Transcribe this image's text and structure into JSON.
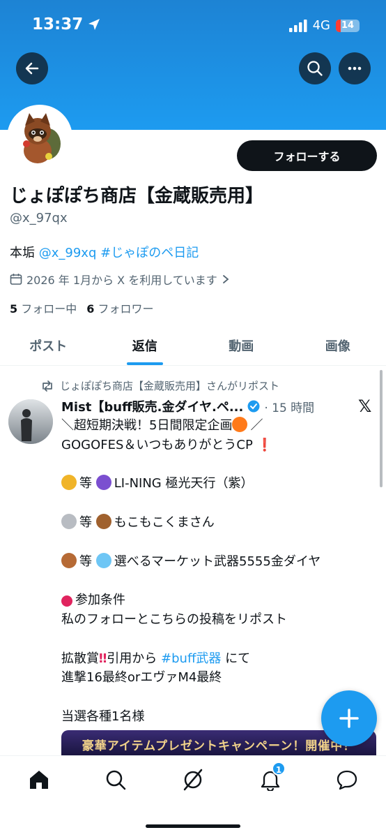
{
  "status_bar": {
    "time": "13:37",
    "network": "4G",
    "battery": "14"
  },
  "header": {
    "back_icon": "arrow-left-icon",
    "search_icon": "search-icon",
    "more_icon": "more-icon"
  },
  "profile": {
    "follow_button": "フォローする",
    "name": "じょぽぽち商店【金蔵販売用】",
    "handle": "@x_97qx",
    "bio_prefix": "本垢",
    "bio_link": "@x_99xq",
    "bio_hashtag": "#じゃぽのペ日記",
    "joined": "2026 年 1月から X を利用しています",
    "following_count": "5",
    "following_label": "フォロー中",
    "followers_count": "6",
    "followers_label": "フォロワー"
  },
  "tabs": [
    {
      "label": "ポスト",
      "active": false
    },
    {
      "label": "返信",
      "active": true
    },
    {
      "label": "動画",
      "active": false
    },
    {
      "label": "画像",
      "active": false
    }
  ],
  "post": {
    "repost_label": "じょぽぽち商店【金蔵販売用】さんがリポスト",
    "author": "Mist【buff販売.金ダイヤ.ペ...",
    "time": "· 15 時間",
    "line1": "＼超短期決戦！5日間限定企画",
    "line1_end": "／",
    "line2": "GOGOFES＆いつもありがとうCP",
    "prize1": "等",
    "prize1_text": "LI-NING 極光天行（紫）",
    "prize2": "等",
    "prize2_text": "もこもこくまさん",
    "prize3": "等",
    "prize3_text": "選べるマーケット武器5555金ダイヤ",
    "cond_title": "参加条件",
    "cond_text": "私のフォローとこちらの投稿をリポスト",
    "spread_prefix": "拡散賞",
    "spread_mid": "引用から",
    "spread_hashtag": "#buff武器",
    "spread_suffix": "にて",
    "spread_line2": "進撃16最終orエヴァM4最終",
    "winners": "当選各種1名様",
    "promo_banner": "豪華アイテムプレゼントキャンペーン！開催中！"
  },
  "bottom_nav": {
    "notification_badge": "1"
  },
  "colors": {
    "accent": "#1d9bf0",
    "text": "#0f1419",
    "secondary": "#536471"
  }
}
